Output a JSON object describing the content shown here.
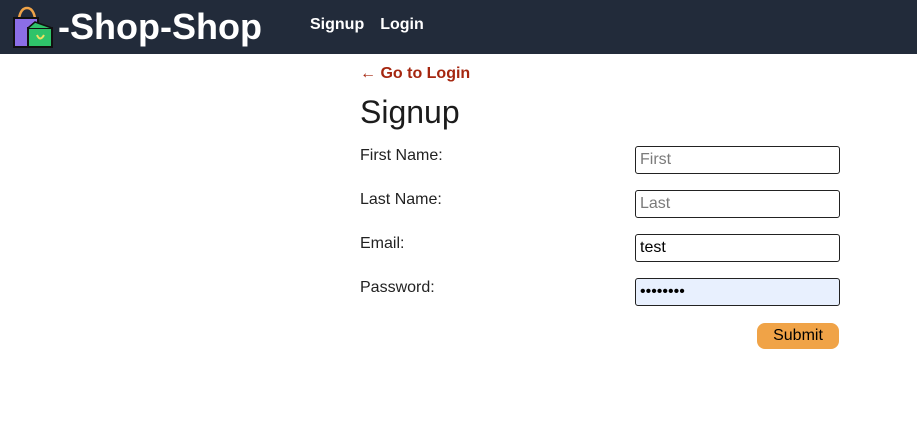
{
  "header": {
    "brand_text": "-Shop-Shop",
    "brand_icon": "shopping-bag-icon",
    "nav": [
      {
        "label": "Signup"
      },
      {
        "label": "Login"
      }
    ]
  },
  "main": {
    "back_link": "← Go to Login",
    "title": "Signup",
    "fields": [
      {
        "label": "First Name:",
        "placeholder": "First",
        "value": ""
      },
      {
        "label": "Last Name:",
        "placeholder": "Last",
        "value": ""
      },
      {
        "label": "Email:",
        "placeholder": "",
        "value": "test"
      },
      {
        "label": "Password:",
        "placeholder": "",
        "value": "********"
      }
    ],
    "submit_label": "Submit"
  },
  "colors": {
    "navbar_bg": "#222b3a",
    "link_accent": "#a5260f",
    "submit_bg": "#f0a347",
    "autofill_bg": "#e8f0fe"
  }
}
